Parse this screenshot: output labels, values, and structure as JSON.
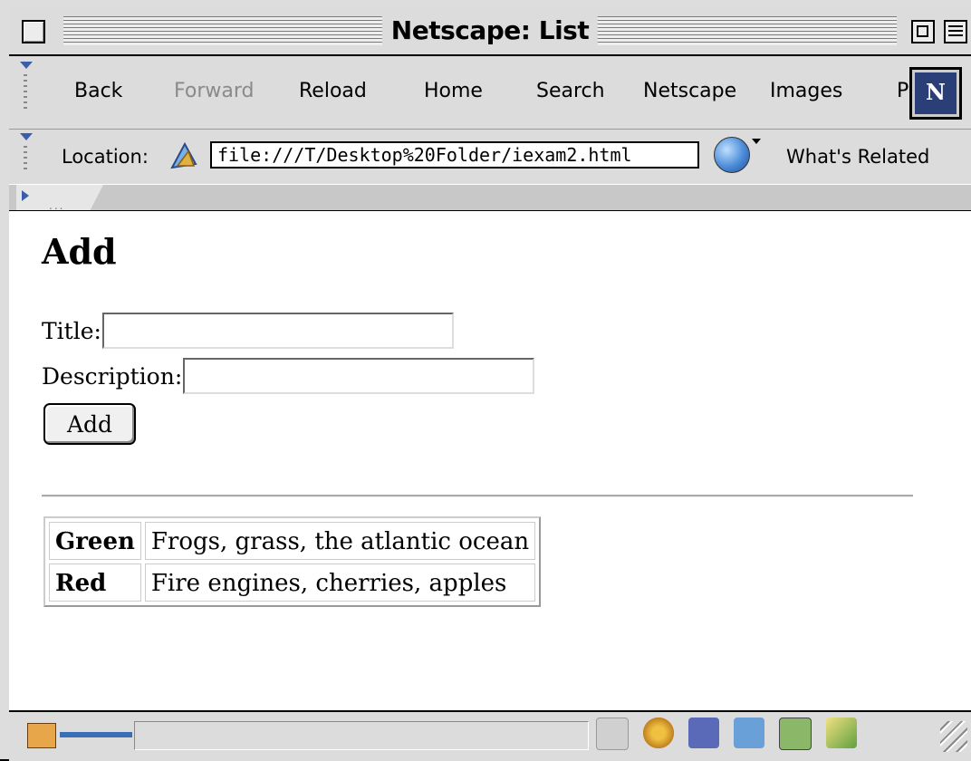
{
  "window": {
    "title": "Netscape: List"
  },
  "toolbar": {
    "buttons": [
      {
        "label": "Back",
        "enabled": true
      },
      {
        "label": "Forward",
        "enabled": false
      },
      {
        "label": "Reload",
        "enabled": true
      },
      {
        "label": "Home",
        "enabled": true
      },
      {
        "label": "Search",
        "enabled": true
      },
      {
        "label": "Netscape",
        "enabled": true
      },
      {
        "label": "Images",
        "enabled": true
      },
      {
        "label": "P",
        "enabled": true
      }
    ],
    "logo_letter": "N"
  },
  "location": {
    "label": "Location:",
    "url": "file:///T/Desktop%20Folder/iexam2.html",
    "related_label": "What's Related"
  },
  "page": {
    "heading": "Add",
    "title_label": "Title:",
    "title_value": "",
    "description_label": "Description:",
    "description_value": "",
    "add_button": "Add",
    "table": [
      {
        "name": "Green",
        "description": "Frogs, grass, the atlantic ocean"
      },
      {
        "name": "Red",
        "description": "Fire engines, cherries, apples"
      }
    ]
  },
  "status": {
    "text": ""
  },
  "colors": {
    "window_bg": "#dddddd",
    "content_bg": "#ffffff",
    "accent": "#3a5fa8"
  },
  "icons": [
    "close-box-icon",
    "zoom-box-icon",
    "collapse-box-icon",
    "netscape-logo-icon",
    "location-bookmark-icon",
    "whats-related-globe-icon",
    "security-lock-icon",
    "connection-plug-icon",
    "grow-box-icon"
  ]
}
